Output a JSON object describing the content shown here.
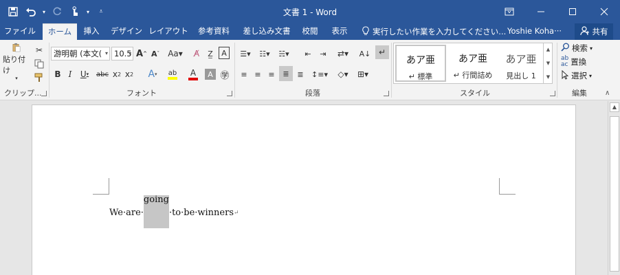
{
  "title_bar": {
    "document_title": "文書 1 - Word",
    "qat_icons": [
      "save-icon",
      "undo-icon",
      "redo-icon",
      "touch-mode-icon",
      "customize-qat-icon"
    ],
    "window_controls": [
      "ribbon-display-icon",
      "minimize-icon",
      "maximize-icon",
      "close-icon"
    ]
  },
  "tabs": [
    {
      "label": "ファイル"
    },
    {
      "label": "ホーム"
    },
    {
      "label": "挿入"
    },
    {
      "label": "デザイン"
    },
    {
      "label": "レイアウト"
    },
    {
      "label": "参考資料"
    },
    {
      "label": "差し込み文書"
    },
    {
      "label": "校閲"
    },
    {
      "label": "表示"
    }
  ],
  "active_tab": "ホーム",
  "tell_me": "実行したい作業を入力してください...",
  "user_name": "Yoshie Koha···",
  "share_label": "共有",
  "ribbon": {
    "clipboard": {
      "label": "クリップ...",
      "paste_label": "貼り付け"
    },
    "font": {
      "label": "フォント",
      "font_name": "游明朝 (本文(",
      "font_size": "10.5"
    },
    "paragraph": {
      "label": "段落"
    },
    "styles": {
      "label": "スタイル",
      "items": [
        {
          "preview": "あア亜",
          "name": "↵ 標準"
        },
        {
          "preview": "あア亜",
          "name": "↵ 行間詰め"
        },
        {
          "preview": "あア亜",
          "name": "見出し 1"
        }
      ]
    },
    "editing": {
      "label": "編集",
      "find": "検索",
      "replace": "置換",
      "select": "選択"
    }
  },
  "document": {
    "before": "We·are·",
    "selected": "going",
    "after": "·to·be·winners",
    "paragraph_mark": "↵"
  },
  "colors": {
    "accent": "#2b579a",
    "ribbon_bg": "#f3f3f3",
    "highlight_yellow": "#ffff00",
    "font_red": "#e00000",
    "selection_gray": "#c6c6c6"
  }
}
